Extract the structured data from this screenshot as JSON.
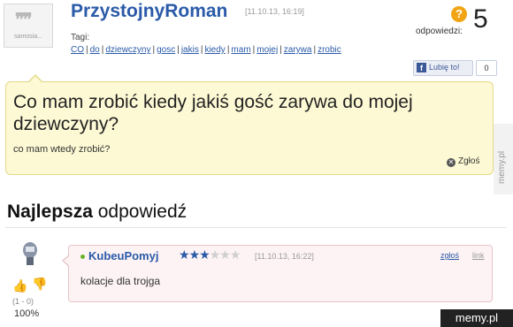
{
  "question": {
    "avatar_label": "samosia...",
    "author": "PrzystojnyRoman",
    "timestamp": "[11.10.13, 16:19]",
    "tags_label": "Tagi:",
    "tags": [
      "CO",
      "do",
      "dziewczyny",
      "gosc",
      "jakis",
      "kiedy",
      "mam",
      "mojej",
      "zarywa",
      "zrobic"
    ],
    "answers_label": "odpowiedzi:",
    "answers_count": "5",
    "like_label": "Lubię to!",
    "like_count": "0",
    "title": "Co mam zrobić kiedy jakiś gość zarywa do mojej dziewczyny?",
    "description": "co mam wtedy zrobić?",
    "report_label": "Zgłoś"
  },
  "best_answer": {
    "heading_bold": "Najlepsza",
    "heading_rest": " odpowiedź",
    "author": "KubeuPomyj",
    "rating": 3,
    "rating_max": 6,
    "timestamp": "[11.10.13, 16:22]",
    "report_label": "zgłoś",
    "link_label": "link",
    "text": "kolacje dla trojga",
    "votes": "(1 - 0)",
    "percent": "100%"
  },
  "watermark": {
    "side": "memy.pl",
    "corner": "memy.pl"
  },
  "colors": {
    "link": "#2a5aa8",
    "question_bg": "#fdf9d4",
    "answer_bg": "#fdf3f4",
    "online_dot": "#6cb32c"
  }
}
